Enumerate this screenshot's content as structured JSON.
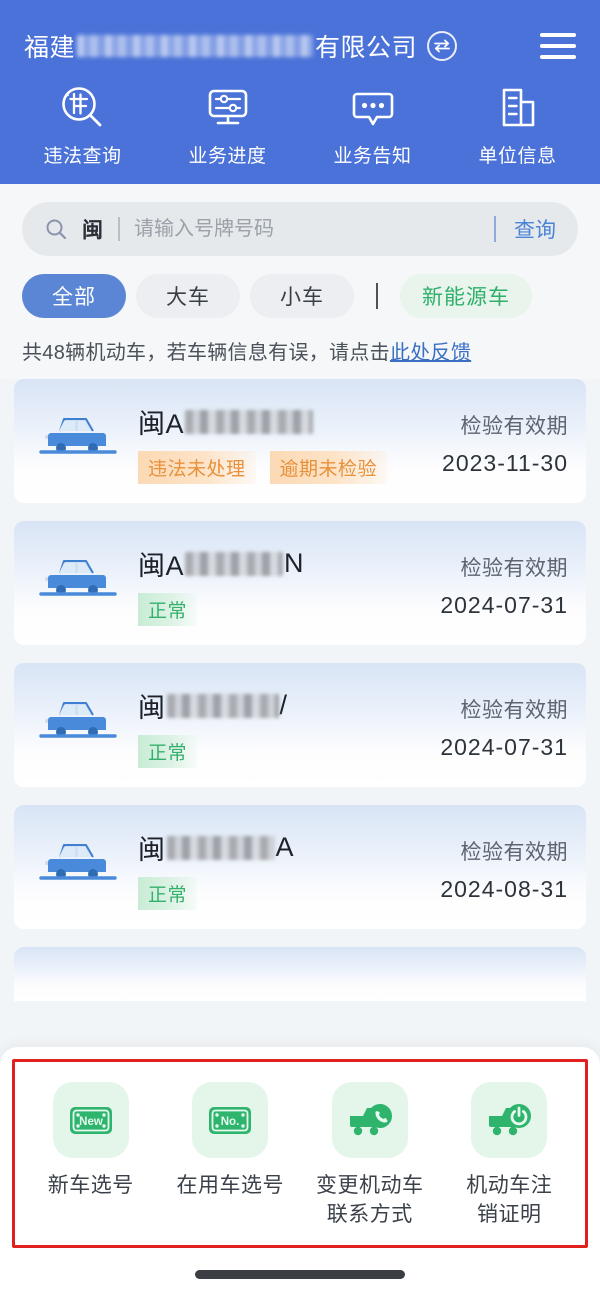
{
  "theme": {
    "header_blue": "#4a72d8",
    "accent_blue": "#4a84d8",
    "green": "#2eb06a",
    "warn_orange": "#e8903a",
    "highlight_red": "#e0211f"
  },
  "header": {
    "company_prefix": "福建",
    "company_suffix": "有限公司",
    "switch_icon": "switch-account-icon",
    "menu_icon": "hamburger-menu-icon",
    "nav": [
      {
        "label": "违法查询",
        "icon": "violation-search-icon"
      },
      {
        "label": "业务进度",
        "icon": "business-progress-icon"
      },
      {
        "label": "业务告知",
        "icon": "business-notice-icon"
      },
      {
        "label": "单位信息",
        "icon": "company-info-icon"
      }
    ]
  },
  "search": {
    "icon": "search-icon",
    "province_prefix": "闽",
    "value": "",
    "placeholder": "请输入号牌号码",
    "button_label": "查询"
  },
  "filters": {
    "chips": [
      {
        "label": "全部",
        "state": "active"
      },
      {
        "label": "大车",
        "state": "default"
      },
      {
        "label": "小车",
        "state": "default"
      },
      {
        "label": "新能源车",
        "state": "green"
      }
    ]
  },
  "info": {
    "text_before": "共48辆机动车，若车辆信息有误，请点击",
    "link_text": "此处反馈",
    "vehicle_count": 48
  },
  "vehicles": [
    {
      "plate_prefix": "闽A",
      "plate_masked": true,
      "mask_width": 128,
      "plate_suffix": "",
      "badges": [
        {
          "label": "违法未处理",
          "type": "warn"
        },
        {
          "label": "逾期未检验",
          "type": "warn"
        }
      ],
      "expiry_label": "检验有效期",
      "expiry_date": "2023-11-30",
      "icon": "car-icon"
    },
    {
      "plate_prefix": "闽A",
      "plate_masked": true,
      "mask_width": 98,
      "plate_suffix": "N",
      "badges": [
        {
          "label": "正常",
          "type": "ok"
        }
      ],
      "expiry_label": "检验有效期",
      "expiry_date": "2024-07-31",
      "icon": "car-icon"
    },
    {
      "plate_prefix": "闽",
      "plate_masked": true,
      "mask_width": 112,
      "plate_suffix": "/",
      "badges": [
        {
          "label": "正常",
          "type": "ok"
        }
      ],
      "expiry_label": "检验有效期",
      "expiry_date": "2024-07-31",
      "icon": "car-icon"
    },
    {
      "plate_prefix": "闽",
      "plate_masked": true,
      "mask_width": 108,
      "plate_suffix": "A",
      "badges": [
        {
          "label": "正常",
          "type": "ok"
        }
      ],
      "expiry_label": "检验有效期",
      "expiry_date": "2024-08-31",
      "icon": "car-icon"
    }
  ],
  "bottom_actions": {
    "highlighted": true,
    "items": [
      {
        "label": "新车选号",
        "icon": "new-plate-icon",
        "icon_text": "New"
      },
      {
        "label": "在用车选号",
        "icon": "existing-plate-icon",
        "icon_text": "No."
      },
      {
        "label": "变更机动车\n联系方式",
        "label_line1": "变更机动车",
        "label_line2": "联系方式",
        "icon": "truck-phone-icon"
      },
      {
        "label": "机动车注\n销证明",
        "label_line1": "机动车注",
        "label_line2": "销证明",
        "icon": "truck-power-icon"
      }
    ]
  }
}
